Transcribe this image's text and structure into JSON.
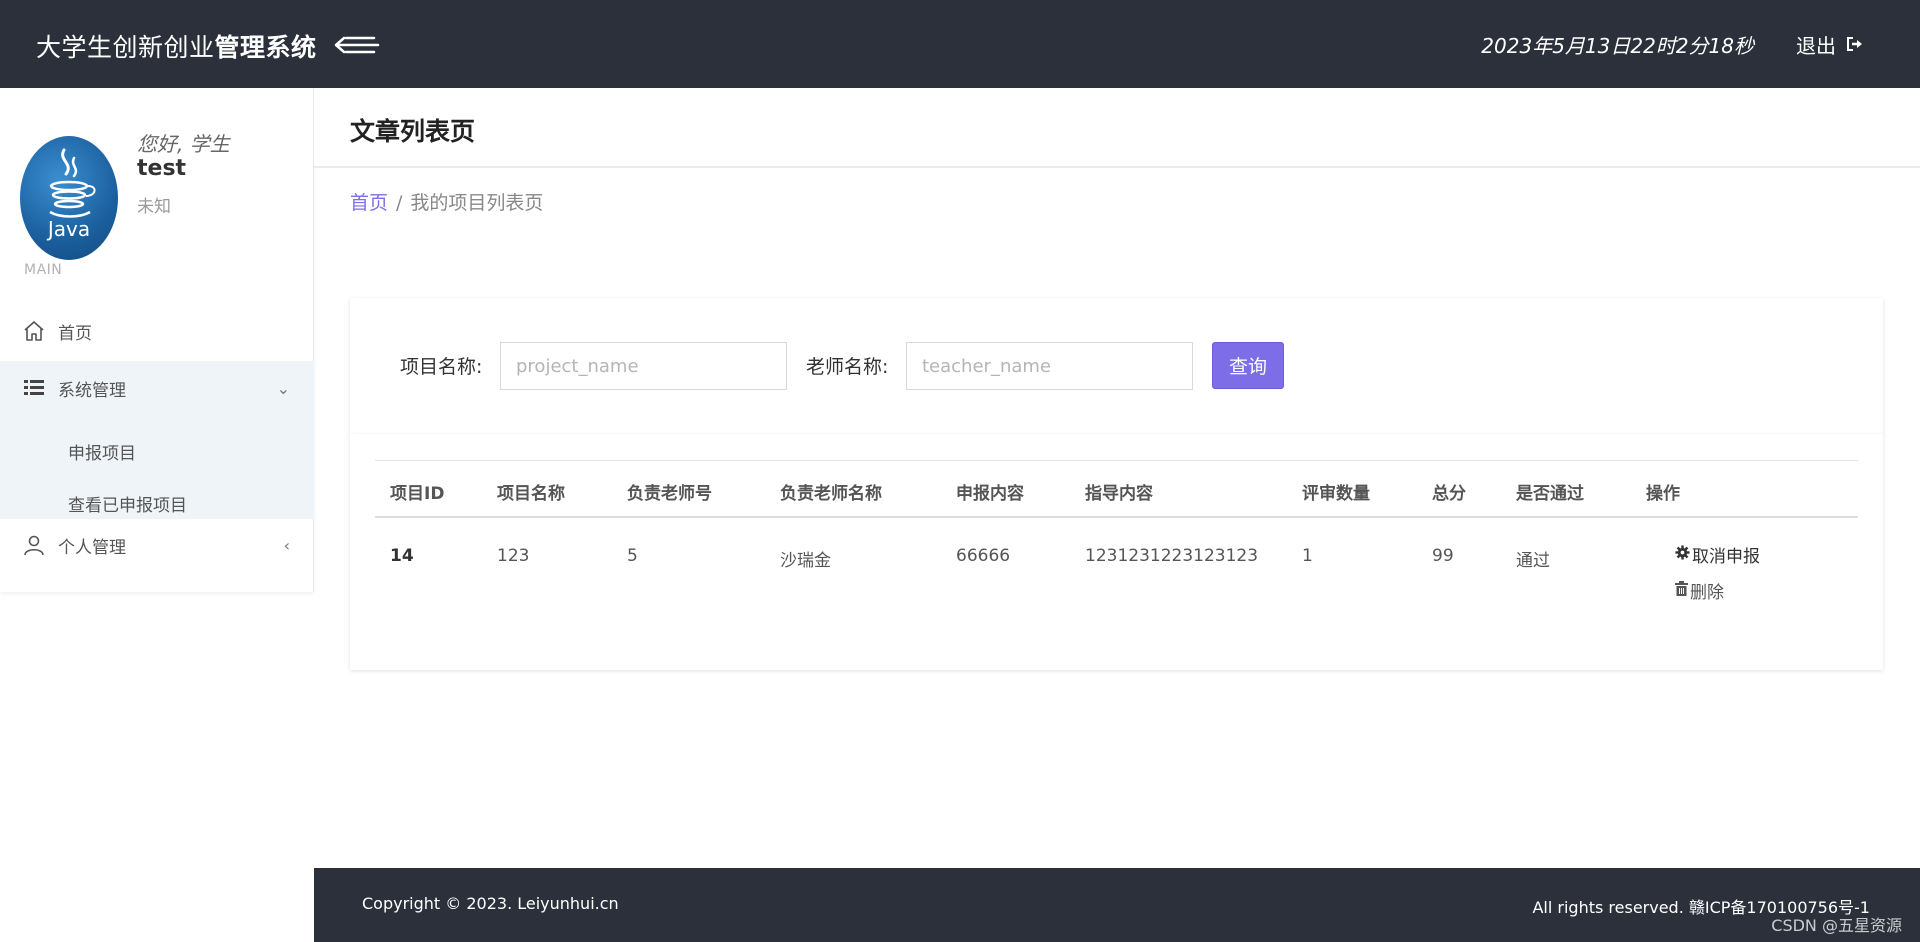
{
  "header": {
    "brand_main": "大学生创新创业",
    "brand_tail": "管理系统",
    "toggle_icon": "menu-fold-icon",
    "datetime": "2023年5月13日22时2分18秒",
    "logout_label": "退出",
    "logout_icon": "sign-out-icon",
    "bg_color": "#2b303b"
  },
  "user": {
    "greeting": "您好, 学生",
    "name": "test",
    "role": "未知",
    "avatar_icon": "java-logo-icon",
    "avatar_text": "Java"
  },
  "sidebar": {
    "section_label": "MAIN",
    "items": [
      {
        "label": "首页",
        "icon": "home-icon"
      },
      {
        "label": "系统管理",
        "icon": "list-icon",
        "chevron": "⌄",
        "expanded": true,
        "children": [
          {
            "label": "申报项目"
          },
          {
            "label": "查看已申报项目"
          }
        ]
      },
      {
        "label": "个人管理",
        "icon": "user-icon",
        "chevron": "‹"
      }
    ]
  },
  "page": {
    "title": "文章列表页",
    "breadcrumb": {
      "home": "首页",
      "sep": "/",
      "current": "我的项目列表页"
    }
  },
  "search": {
    "project_label": "项目名称:",
    "project_placeholder": "project_name",
    "project_value": "",
    "teacher_label": "老师名称:",
    "teacher_placeholder": "teacher_name",
    "teacher_value": "",
    "query_label": "查询",
    "accent_color": "#7d6ee8"
  },
  "table": {
    "columns": [
      "项目ID",
      "项目名称",
      "负责老师号",
      "负责老师名称",
      "申报内容",
      "指导内容",
      "评审数量",
      "总分",
      "是否通过",
      "操作"
    ],
    "rows": [
      {
        "id": "14",
        "name": "123",
        "teacher_no": "5",
        "teacher_name": "沙瑞金",
        "content": "66666",
        "guide": "1231231223123123",
        "review_count": "1",
        "score": "99",
        "passed": "通过",
        "actions": [
          {
            "label": "取消申报",
            "icon": "gear-icon"
          },
          {
            "label": "删除",
            "icon": "trash-icon"
          }
        ]
      }
    ]
  },
  "footer": {
    "copyright": "Copyright © 2023. Leiyunhui.cn",
    "rights": "All rights reserved. 赣ICP备170100756号-1",
    "watermark": "CSDN @五星资源"
  }
}
